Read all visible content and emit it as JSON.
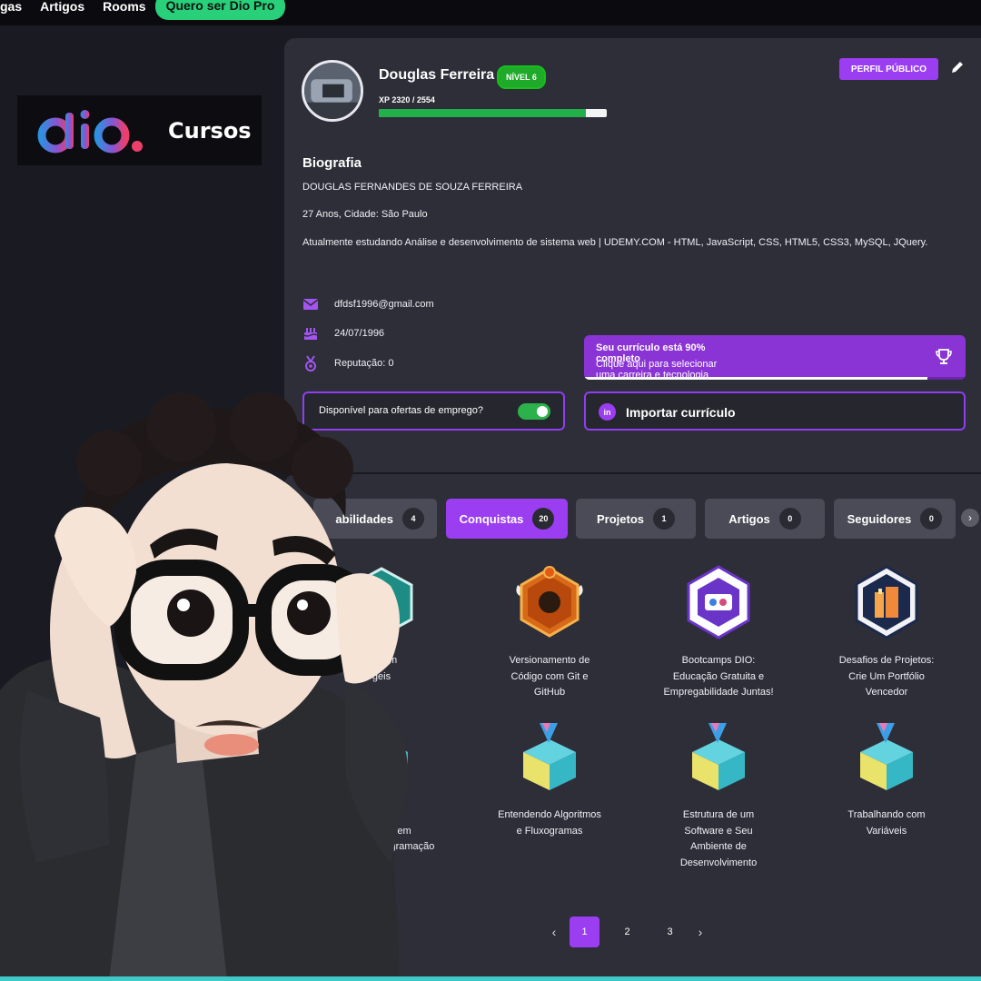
{
  "nav": {
    "items": [
      "gas",
      "Artigos",
      "Rooms"
    ],
    "cta": "Quero ser Dio Pro"
  },
  "logo": {
    "brand": "dio.",
    "section": "Cursos"
  },
  "profile": {
    "name": "Douglas Ferreira",
    "level": "NÍVEL 6",
    "xp_text": "XP 2320 / 2554",
    "xp_progress": 0.908,
    "public_button": "PERFIL PÚBLICO"
  },
  "bio": {
    "heading": "Biografia",
    "full_name": "DOUGLAS FERNANDES DE SOUZA FERREIRA",
    "age_city": "27 Anos, Cidade: São Paulo",
    "summary": "Atualmente estudando Análise e desenvolvimento de sistema web | UDEMY.COM - HTML, JavaScript, CSS, HTML5, CSS3, MySQL, JQuery."
  },
  "info": {
    "email": "dfdsf1996@gmail.com",
    "birthday": "24/07/1996",
    "reputation": "Reputação: 0"
  },
  "resume_promo": {
    "title": "Seu currículo está 90% completo",
    "subtitle": "Clique aqui para selecionar uma carreira e tecnologia que domina",
    "progress": 0.9
  },
  "job_toggle": {
    "label": "Disponível para ofertas de emprego?",
    "enabled": true
  },
  "import": {
    "badge": "in",
    "label": "Importar currículo"
  },
  "tabs": [
    {
      "label": "abilidades",
      "count": "4"
    },
    {
      "label": "Conquistas",
      "count": "20",
      "active": true
    },
    {
      "label": "Projetos",
      "count": "1"
    },
    {
      "label": "Artigos",
      "count": "0"
    },
    {
      "label": "Seguidores",
      "count": "0"
    }
  ],
  "tab_next": "›",
  "badges": [
    {
      "caption": "Tra em\ngeis",
      "icon": "green-gear-badge-icon"
    },
    {
      "caption": "Versionamento de\nCódigo com Git e\nGitHub",
      "icon": "github-badge-icon"
    },
    {
      "caption": "Bootcamps DIO:\nEducação Gratuita e\nEmpregabilidade Juntas!",
      "icon": "dio-badge-icon"
    },
    {
      "caption": "Desafios de Projetos:\nCrie Um Portfólio\nVencedor",
      "icon": "portfolio-badge-icon"
    },
    {
      "caption": "ção aos\ns Básicos em\nLógica de Programação",
      "icon": "cube-badge-icon"
    },
    {
      "caption": "Entendendo Algoritmos\ne Fluxogramas",
      "icon": "cube-badge-icon"
    },
    {
      "caption": "Estrutura de um\nSoftware e Seu\nAmbiente de\nDesenvolvimento",
      "icon": "cube-badge-icon"
    },
    {
      "caption": "Trabalhando com\nVariáveis",
      "icon": "cube-badge-icon"
    }
  ],
  "pagination": {
    "prev": "‹",
    "pages": [
      "1",
      "2",
      "3"
    ],
    "current": "1",
    "next": "›"
  },
  "colors": {
    "accent": "#9b3ef2",
    "card": "#2d2e38",
    "bg": "#1a1b22",
    "success": "#1faa2a"
  }
}
